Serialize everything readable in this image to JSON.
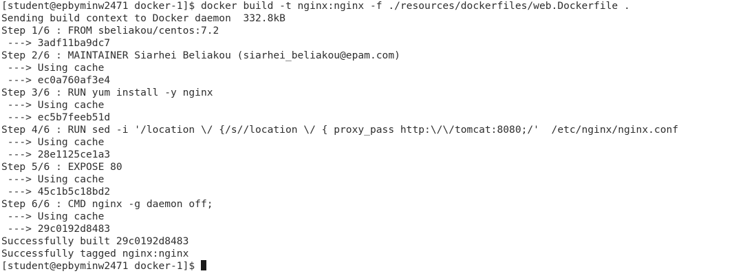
{
  "terminal": {
    "lines": [
      "[student@epbyminw2471 docker-1]$ docker build -t nginx:nginx -f ./resources/dockerfiles/web.Dockerfile .",
      "Sending build context to Docker daemon  332.8kB",
      "Step 1/6 : FROM sbeliakou/centos:7.2",
      " ---> 3adf11ba9dc7",
      "Step 2/6 : MAINTAINER Siarhei Beliakou (siarhei_beliakou@epam.com)",
      " ---> Using cache",
      " ---> ec0a760af3e4",
      "Step 3/6 : RUN yum install -y nginx",
      " ---> Using cache",
      " ---> ec5b7feeb51d",
      "Step 4/6 : RUN sed -i '/location \\/ {/s//location \\/ { proxy_pass http:\\/\\/tomcat:8080;/'  /etc/nginx/nginx.conf",
      " ---> Using cache",
      " ---> 28e1125ce1a3",
      "Step 5/6 : EXPOSE 80",
      " ---> Using cache",
      " ---> 45c1b5c18bd2",
      "Step 6/6 : CMD nginx -g daemon off;",
      " ---> Using cache",
      " ---> 29c0192d8483",
      "Successfully built 29c0192d8483",
      "Successfully tagged nginx:nginx"
    ],
    "prompt": "[student@epbyminw2471 docker-1]$ "
  }
}
